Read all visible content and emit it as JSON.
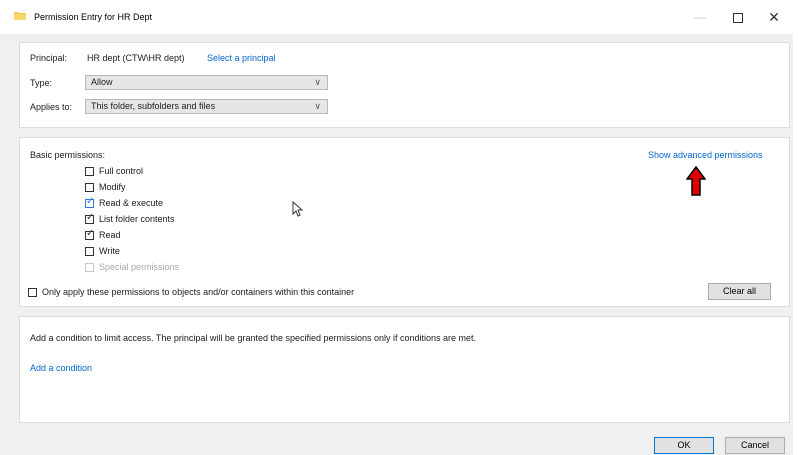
{
  "window": {
    "title": "Permission Entry for HR Dept",
    "minimize_glyph": "—",
    "close_glyph": "✕"
  },
  "principal": {
    "label": "Principal:",
    "value": "HR dept (CTW\\HR dept)",
    "link": "Select a principal"
  },
  "type": {
    "label": "Type:",
    "value": "Allow"
  },
  "applies_to": {
    "label": "Applies to:",
    "value": "This folder, subfolders and files"
  },
  "chevron_glyph": "∨",
  "permissions": {
    "heading": "Basic permissions:",
    "advanced_link": "Show advanced permissions",
    "items": [
      {
        "label": "Full control",
        "checked": false
      },
      {
        "label": "Modify",
        "checked": false
      },
      {
        "label": "Read & execute",
        "checked": true
      },
      {
        "label": "List folder contents",
        "checked": true
      },
      {
        "label": "Read",
        "checked": true
      },
      {
        "label": "Write",
        "checked": false
      },
      {
        "label": "Special permissions",
        "checked": false,
        "disabled": true
      }
    ],
    "only_apply_label": "Only apply these permissions to objects and/or containers within this container",
    "clear_all": "Clear all"
  },
  "condition": {
    "description": "Add a condition to limit access. The principal will be granted the specified permissions only if conditions are met.",
    "add_link": "Add a condition"
  },
  "footer": {
    "ok": "OK",
    "cancel": "Cancel"
  },
  "icons": {
    "folder": "folder-icon",
    "annotation_arrow": "red-up-arrow-icon",
    "cursor": "mouse-pointer-icon"
  },
  "colors": {
    "link": "#0066cc",
    "check_blue": "#2a7ad6",
    "arrow_red": "#e00000",
    "folder_yellow": "#f2c94c"
  }
}
